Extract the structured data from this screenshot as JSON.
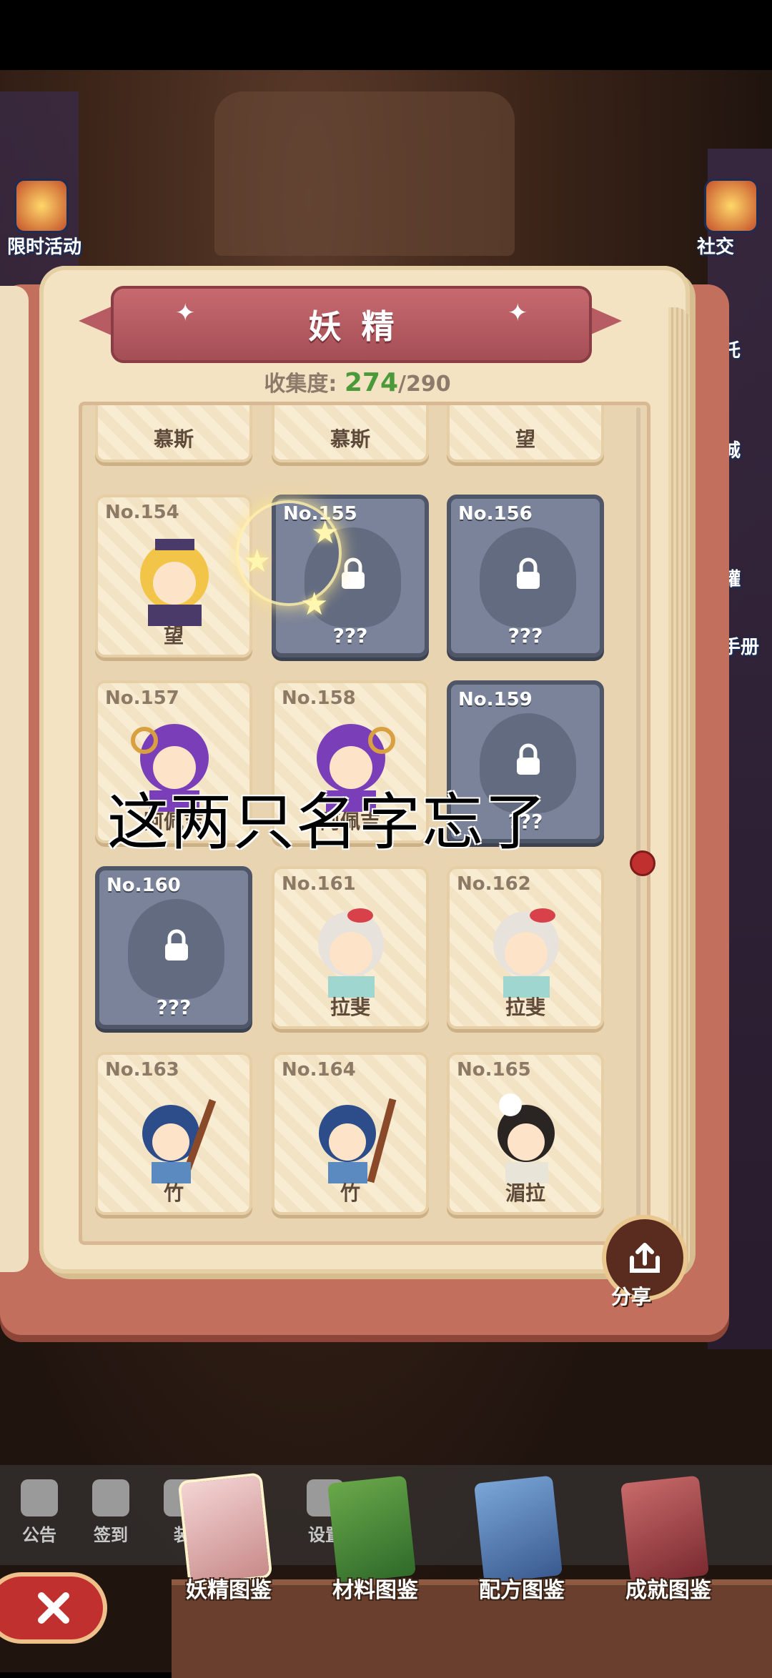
{
  "side_left": {
    "label": "限时活动"
  },
  "side_right": {
    "labels": [
      "社交",
      "托",
      "城",
      "罐",
      "手册"
    ]
  },
  "book": {
    "title": "妖精",
    "collection_label": "收集度:",
    "collection_current": "274",
    "collection_total": "/290"
  },
  "cards_partial": [
    {
      "name": "慕斯"
    },
    {
      "name": "慕斯"
    },
    {
      "name": "望"
    }
  ],
  "cards": [
    {
      "no": "No.154",
      "name": "望",
      "locked": false
    },
    {
      "no": "No.155",
      "name": "???",
      "locked": true
    },
    {
      "no": "No.156",
      "name": "???",
      "locked": true
    },
    {
      "no": "No.157",
      "name": "阿佩吉",
      "locked": false
    },
    {
      "no": "No.158",
      "name": "阿佩吉",
      "locked": false
    },
    {
      "no": "No.159",
      "name": "???",
      "locked": true
    },
    {
      "no": "No.160",
      "name": "???",
      "locked": true
    },
    {
      "no": "No.161",
      "name": "拉斐",
      "locked": false
    },
    {
      "no": "No.162",
      "name": "拉斐",
      "locked": false
    },
    {
      "no": "No.163",
      "name": "竹",
      "locked": false
    },
    {
      "no": "No.164",
      "name": "竹",
      "locked": false
    },
    {
      "no": "No.165",
      "name": "湄拉",
      "locked": false
    }
  ],
  "overlay_text": "这两只名字忘了",
  "share": {
    "label": "分享"
  },
  "dim_menu": [
    "公告",
    "签到",
    "装",
    "设置"
  ],
  "tabs": [
    {
      "label": "妖精图鉴",
      "color": "#d8a0a0",
      "active": true
    },
    {
      "label": "材料图鉴",
      "color": "#4f8a3a",
      "active": false
    },
    {
      "label": "配方图鉴",
      "color": "#4a78b0",
      "active": false
    },
    {
      "label": "成就图鉴",
      "color": "#b0484a",
      "active": false
    }
  ],
  "colors": {
    "ribbon": "#b65c62",
    "locked_card": "#7a8399",
    "collection_green": "#4a9a3a"
  }
}
